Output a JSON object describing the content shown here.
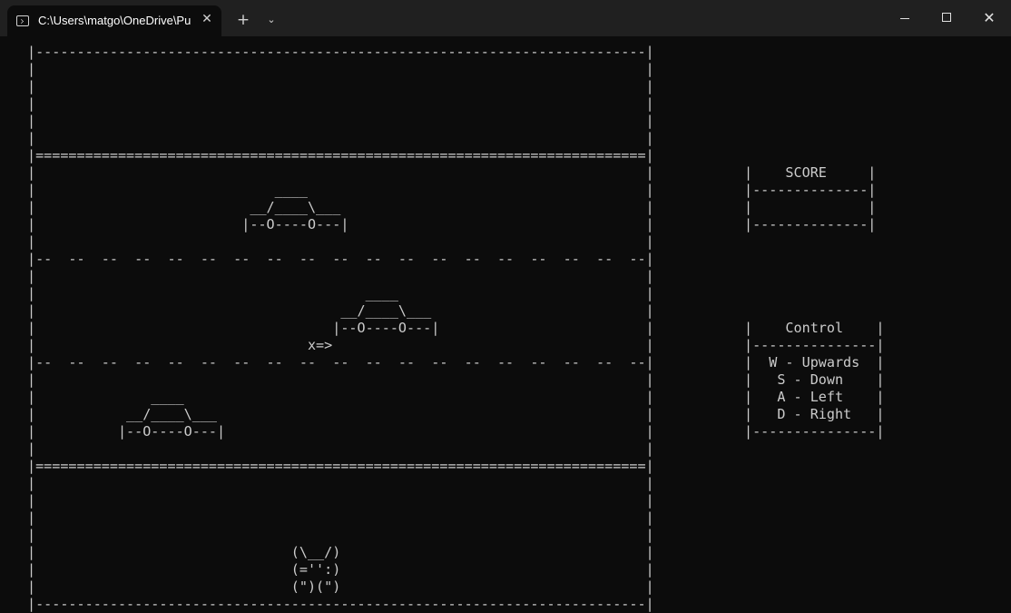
{
  "window": {
    "tab_title": "C:\\Users\\matgo\\OneDrive\\Pu",
    "tab_icon": "terminal-icon",
    "new_tab_glyph": "+",
    "dropdown_glyph": "⌄",
    "close_tab_glyph": "✕",
    "close_window_glyph": "✕"
  },
  "game": {
    "lines": [
      "|--------------------------------------------------------------------------|",
      "|                                                                          |",
      "|                                                                          |",
      "|                                                                          |",
      "|                                                                          |",
      "|                                                                          |",
      "|==========================================================================|",
      "|                                                                          |",
      "|                             ____                                         |",
      "|                          __/____\\___                                     |",
      "|                         |--O----O---|                                    |",
      "|                                                                          |",
      "|--  --  --  --  --  --  --  --  --  --  --  --  --  --  --  --  --  --  --|",
      "|                                                                          |",
      "|                                        ____                              |",
      "|                                     __/____\\___                          |",
      "|                                    |--O----O---|                         |",
      "|                                 x=>                                      |",
      "|--  --  --  --  --  --  --  --  --  --  --  --  --  --  --  --  --  --  --|",
      "|                                                                          |",
      "|              ____                                                        |",
      "|           __/____\\___                                                    |",
      "|          |--O----O---|                                                   |",
      "|                                                                          |",
      "|==========================================================================|",
      "|                                                                          |",
      "|                                                                          |",
      "|                                                                          |",
      "|                                                                          |",
      "|                               (\\__/)                                     |",
      "|                               (='':)                                     |",
      "|                               (\")(\")                                     |",
      "|--------------------------------------------------------------------------|"
    ]
  },
  "score_panel": {
    "lines": [
      "|    SCORE     |",
      "|--------------|",
      "|              |",
      "|--------------|"
    ]
  },
  "control_panel": {
    "lines": [
      "|    Control    |",
      "|---------------|",
      "|  W - Upwards  |",
      "|   S - Down    |",
      "|   A - Left    |",
      "|   D - Right   |",
      "|---------------|"
    ]
  }
}
